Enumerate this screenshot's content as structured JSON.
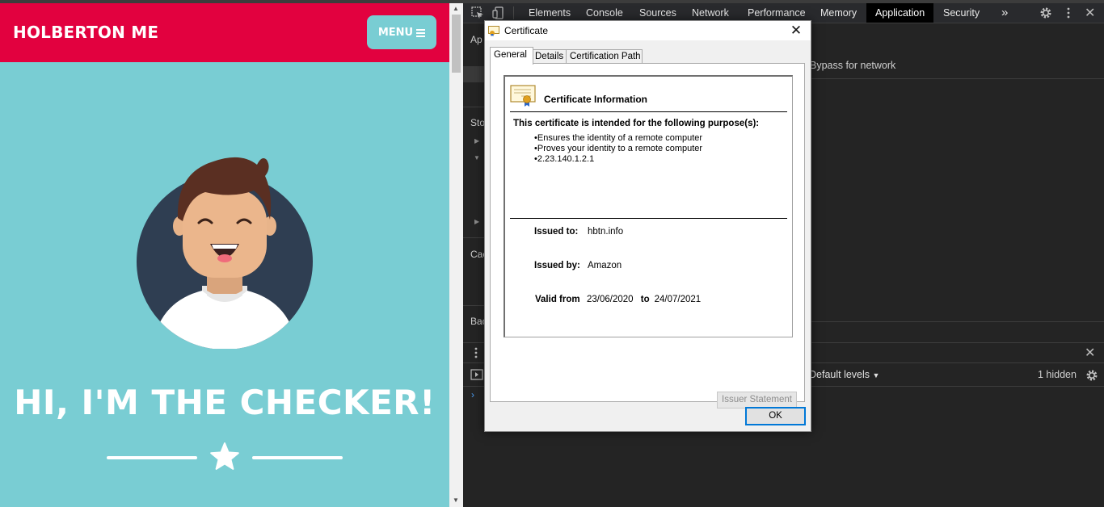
{
  "site": {
    "brand": "HOLBERTON ME",
    "menu_label": "MENU",
    "hero_title": "HI, I'M THE CHECKER!"
  },
  "devtools": {
    "tabs": [
      "Elements",
      "Console",
      "Sources",
      "Network",
      "Performance",
      "Memory",
      "Application",
      "Security"
    ],
    "active_tab": "Application",
    "more_tabs": "»",
    "sidebar_fragments": [
      "Ap",
      "Sto",
      "Cac",
      "Bac"
    ],
    "bypass_label": "Bypass for network",
    "levels_label": "Default levels",
    "hidden_count": "1 hidden",
    "prompt_symbol": "›"
  },
  "dialog": {
    "title": "Certificate",
    "close_label": "✕",
    "tabs": [
      "General",
      "Details",
      "Certification Path"
    ],
    "active_tab": "General",
    "info_title": "Certificate Information",
    "purpose_heading": "This certificate is intended for the following purpose(s):",
    "purposes": [
      "Ensures the identity of a remote computer",
      "Proves your identity to a remote computer",
      "2.23.140.1.2.1"
    ],
    "issued_to_label": "Issued to:",
    "issued_to": "hbtn.info",
    "issued_by_label": "Issued by:",
    "issued_by": "Amazon",
    "valid_from_label": "Valid from",
    "valid_from": "23/06/2020",
    "to_label": "to",
    "valid_to": "24/07/2021",
    "issuer_statement_label": "Issuer Statement",
    "ok_label": "OK"
  },
  "colors": {
    "site_red": "#e2013f",
    "site_teal": "#79cdd3",
    "devtools_bg": "#242424",
    "dialog_bg": "#f0f0f0"
  }
}
